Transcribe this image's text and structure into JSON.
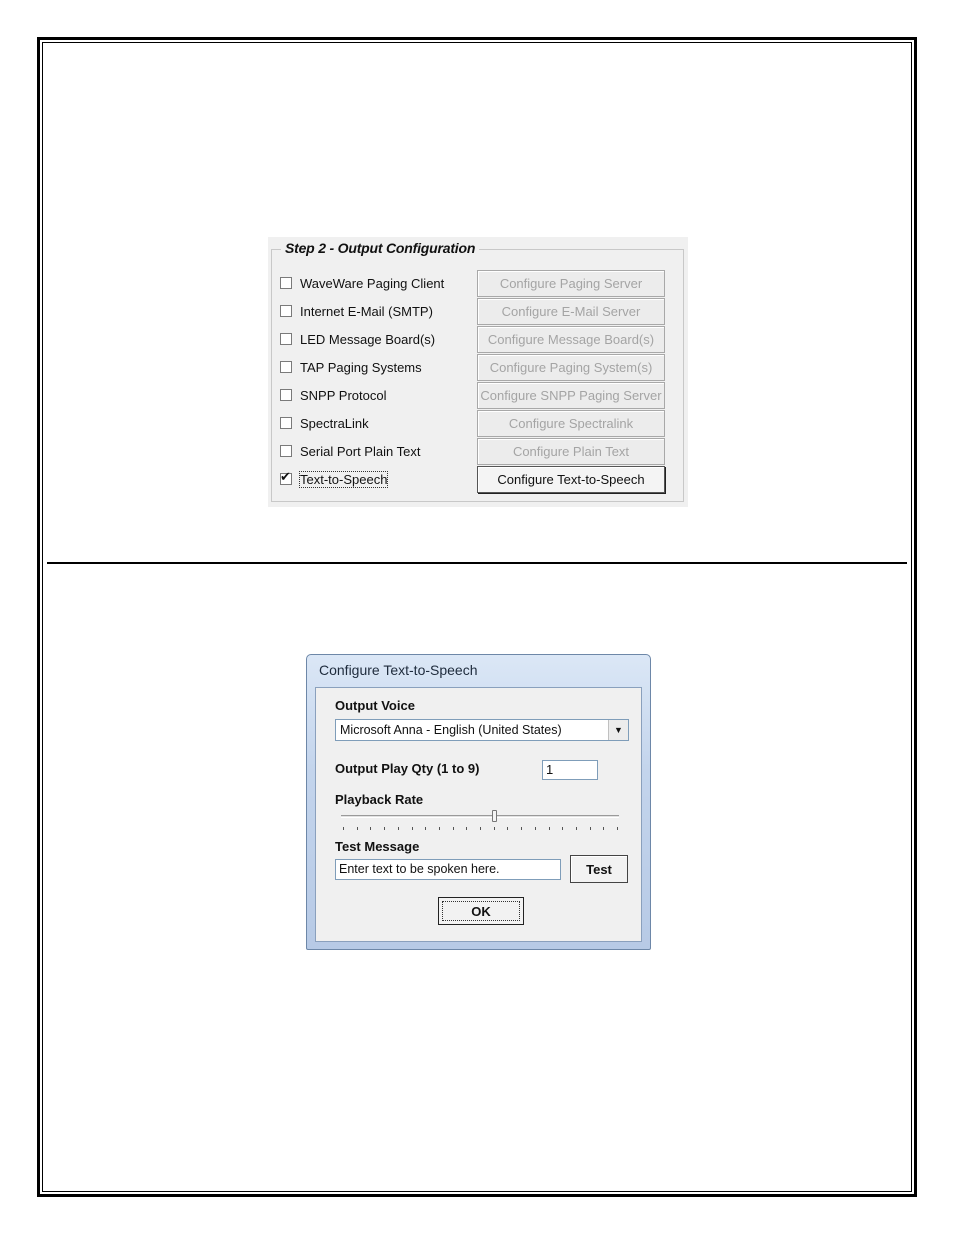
{
  "output_configuration": {
    "group_title": "Step 2 - Output Configuration",
    "options": [
      {
        "label": "WaveWare Paging Client",
        "checked": false,
        "button": "Configure Paging Server",
        "button_enabled": false
      },
      {
        "label": "Internet E-Mail (SMTP)",
        "checked": false,
        "button": "Configure E-Mail Server",
        "button_enabled": false
      },
      {
        "label": "LED Message Board(s)",
        "checked": false,
        "button": "Configure Message Board(s)",
        "button_enabled": false
      },
      {
        "label": "TAP Paging Systems",
        "checked": false,
        "button": "Configure Paging System(s)",
        "button_enabled": false
      },
      {
        "label": "SNPP Protocol",
        "checked": false,
        "button": "Configure SNPP Paging Server",
        "button_enabled": false
      },
      {
        "label": "SpectraLink",
        "checked": false,
        "button": "Configure Spectralink",
        "button_enabled": false
      },
      {
        "label": "Serial Port Plain Text",
        "checked": false,
        "button": "Configure Plain Text",
        "button_enabled": false
      },
      {
        "label": "Text-to-Speech",
        "checked": true,
        "button": "Configure Text-to-Speech",
        "button_enabled": true
      }
    ],
    "check_glyph": "✔"
  },
  "tts_dialog": {
    "title": "Configure Text-to-Speech",
    "output_voice_label": "Output Voice",
    "output_voice_value": "Microsoft Anna - English (United States)",
    "dropdown_arrow": "▼",
    "play_qty_label": "Output Play Qty (1 to 9)",
    "play_qty_value": "1",
    "playback_rate_label": "Playback Rate",
    "playback_rate_value": 0.55,
    "test_message_label": "Test Message",
    "test_message_value": "Enter text to be spoken here.",
    "test_button": "Test",
    "ok_button": "OK"
  },
  "colors": {
    "disabled_text": "#a4a4a4",
    "dialog_frame": "#c3d4ec"
  }
}
